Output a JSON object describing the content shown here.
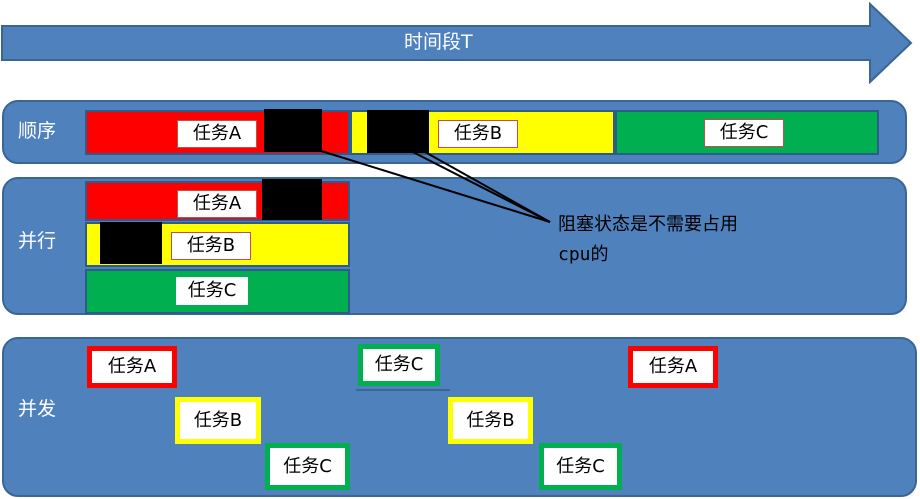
{
  "time_arrow": {
    "label": "时间段T"
  },
  "colors": {
    "panel": "#4f81bd",
    "red": "#ff0000",
    "yellow": "#ffff00",
    "green": "#00b050",
    "blocked": "#000000"
  },
  "sequential": {
    "label": "顺序",
    "tasks": [
      "任务A",
      "任务B",
      "任务C"
    ]
  },
  "parallel": {
    "label": "并行",
    "tasks": [
      "任务A",
      "任务B",
      "任务C"
    ]
  },
  "concurrent": {
    "label": "并发",
    "tasks": [
      "任务A",
      "任务C",
      "任务A",
      "任务B",
      "任务B",
      "任务C",
      "任务C"
    ]
  },
  "annotation": {
    "line1": "阻塞状态是不需要占用",
    "line2": "cpu的"
  }
}
